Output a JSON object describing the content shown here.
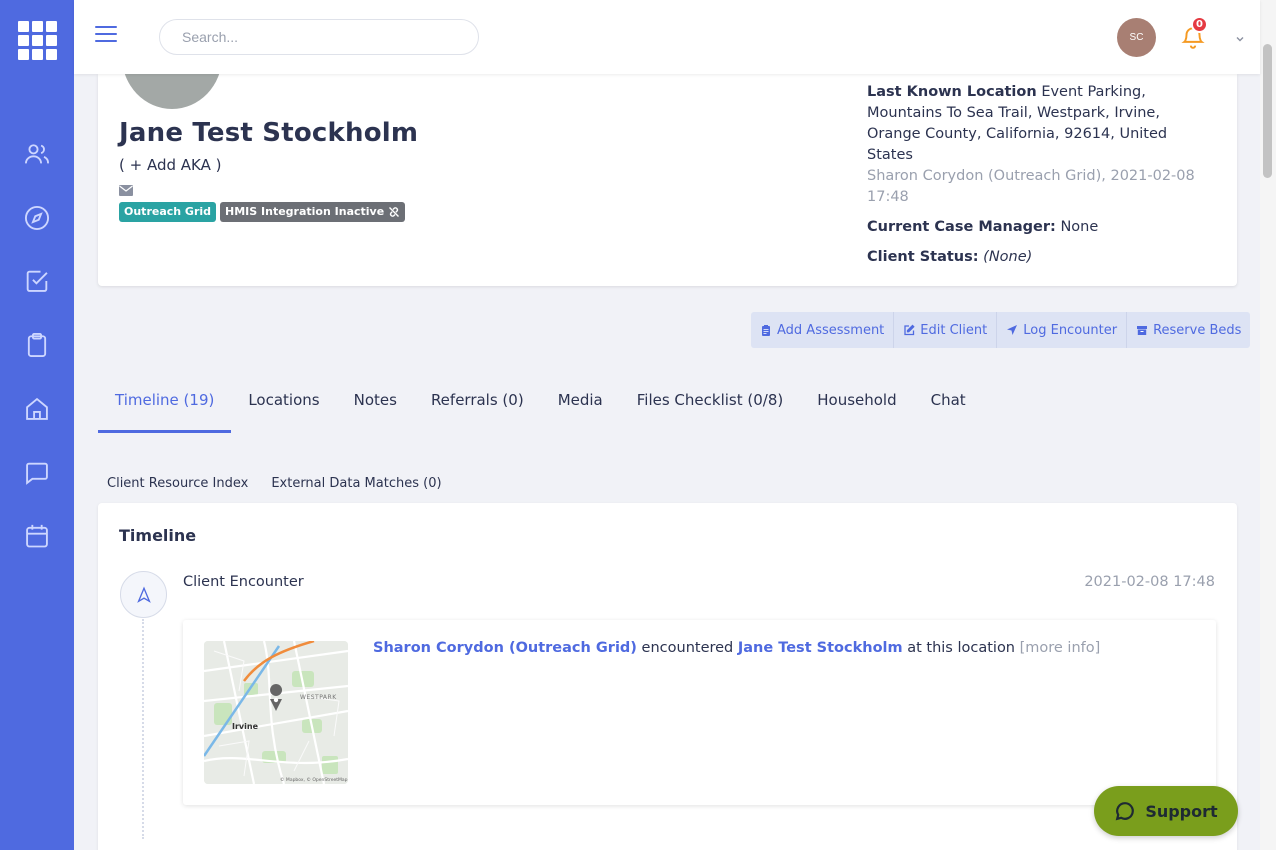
{
  "topbar": {
    "search_placeholder": "Search...",
    "avatar_initials": "SC",
    "notification_count": "0"
  },
  "sidebar": {
    "items": [
      {
        "icon": "users-icon"
      },
      {
        "icon": "compass-icon"
      },
      {
        "icon": "checkbox-icon"
      },
      {
        "icon": "clipboard-icon"
      },
      {
        "icon": "house-icon"
      },
      {
        "icon": "chat-icon"
      },
      {
        "icon": "calendar-icon"
      }
    ]
  },
  "profile": {
    "name": "Jane Test Stockholm",
    "aka": "( + Add AKA )",
    "badges": {
      "outreach": "Outreach Grid",
      "hmis": "HMIS Integration Inactive"
    },
    "last_location_label": "Last Known Location",
    "last_location_value": "Event Parking, Mountains To Sea Trail, Westpark, Irvine, Orange County, California, 92614, United States",
    "last_location_meta": "Sharon Corydon (Outreach Grid), 2021-02-08 17:48",
    "case_manager_label": "Current Case Manager:",
    "case_manager_value": "None",
    "client_status_label": "Client Status:",
    "client_status_value": "(None)"
  },
  "actions": {
    "add_assessment": "Add Assessment",
    "edit_client": "Edit Client",
    "log_encounter": "Log Encounter",
    "reserve_beds": "Reserve Beds"
  },
  "tabs": [
    {
      "label": "Timeline (19)"
    },
    {
      "label": "Locations"
    },
    {
      "label": "Notes"
    },
    {
      "label": "Referrals (0)"
    },
    {
      "label": "Media"
    },
    {
      "label": "Files Checklist (0/8)"
    },
    {
      "label": "Household"
    },
    {
      "label": "Chat"
    }
  ],
  "subtabs": [
    {
      "label": "Client Resource Index"
    },
    {
      "label": "External Data Matches (0)"
    }
  ],
  "timeline": {
    "title": "Timeline",
    "event": {
      "title": "Client Encounter",
      "date": "2021-02-08 17:48",
      "actor": "Sharon Corydon (Outreach Grid)",
      "verb": "encountered",
      "client": "Jane Test Stockholm",
      "suffix": "at this location",
      "more": "[more info]",
      "map_labels": {
        "city": "Irvine",
        "district": "WESTPARK",
        "attribution": "© Mapbox, © OpenStreetMap"
      }
    }
  },
  "support": {
    "label": "Support"
  },
  "colors": {
    "primary": "#4f6ae0",
    "sidebar": "#4f6ae0",
    "badge_teal": "#2aa3a3",
    "badge_gray": "#6c6f75",
    "support_green": "#7a9e1c",
    "notify_red": "#e53a42"
  }
}
